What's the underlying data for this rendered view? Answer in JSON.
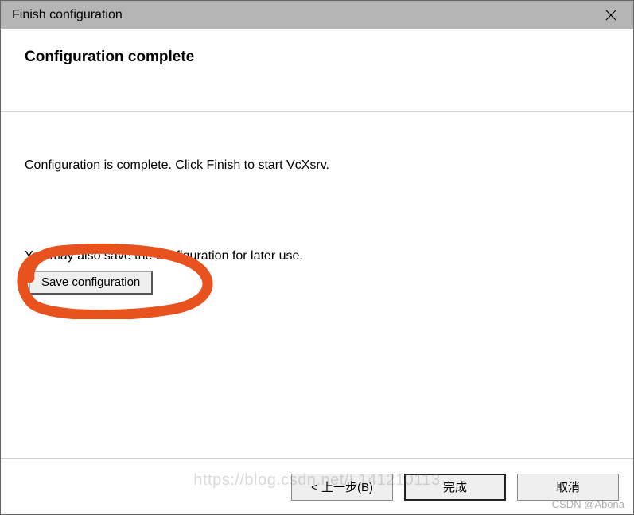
{
  "titlebar": {
    "title": "Finish configuration"
  },
  "header": {
    "heading": "Configuration complete"
  },
  "content": {
    "message1": "Configuration is complete. Click Finish to start VcXsrv.",
    "message2": "You may also save the configuration for later use.",
    "save_button_label": "Save configuration"
  },
  "footer": {
    "back_label": "< 上一步(B)",
    "finish_label": "完成",
    "cancel_label": "取消"
  },
  "watermark": {
    "line1": "https://blog.csdn.net/L141210113",
    "line2": "CSDN @Abona"
  }
}
